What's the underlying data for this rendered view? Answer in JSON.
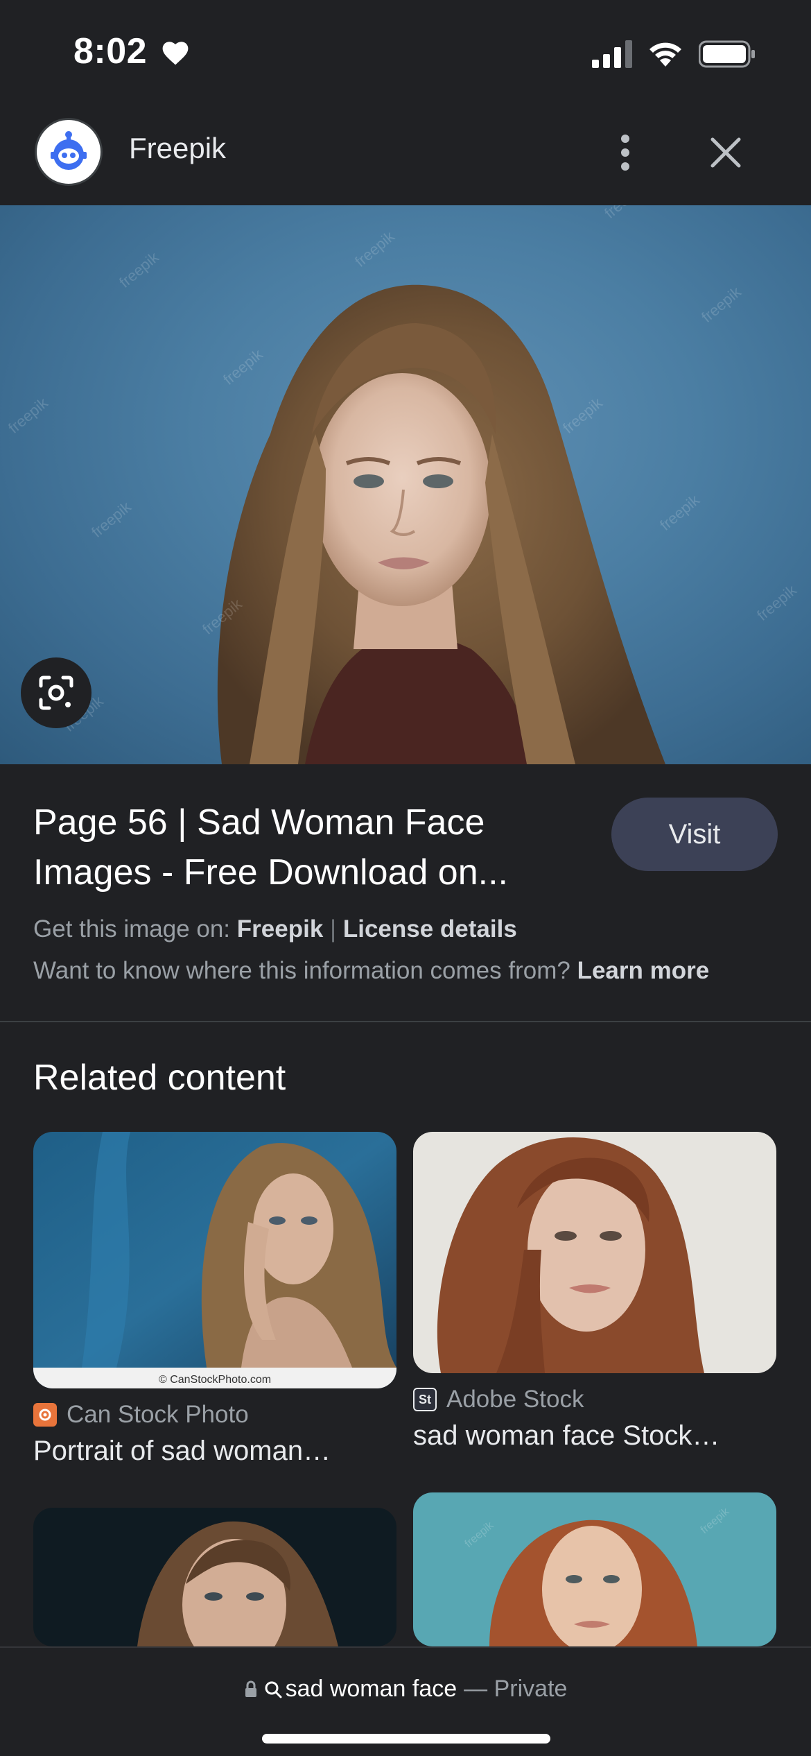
{
  "status_bar": {
    "time": "8:02",
    "icons": [
      "heart-icon",
      "cellular-signal-icon",
      "wifi-icon",
      "battery-icon"
    ]
  },
  "header": {
    "site_name": "Freepik",
    "avatar_icon": "freepik-robot-logo",
    "menu_icon": "more-vert-icon",
    "close_icon": "close-icon"
  },
  "hero": {
    "lens_icon": "google-lens-icon",
    "watermark_text": "freepik"
  },
  "result": {
    "title": "Page 56 | Sad Woman Face Images - Free Download on...",
    "visit_label": "Visit",
    "get_image_prefix": "Get this image on:",
    "get_image_source": "Freepik",
    "separator": "|",
    "license_label": "License details",
    "info_prefix": "Want to know where this information comes from?",
    "learn_more_label": "Learn more"
  },
  "related": {
    "heading": "Related content",
    "items": [
      {
        "source": "Can Stock Photo",
        "title": "Portrait of sad woman…",
        "image_caption": "© CanStockPhoto.com",
        "source_color": "#e8743b"
      },
      {
        "source": "Adobe Stock",
        "title": "sad woman face Stock…",
        "source_badge": "St",
        "source_color": "#2c2f3a"
      }
    ]
  },
  "bottom_bar": {
    "query": "sad woman face",
    "mode": "— Private",
    "icons": [
      "lock-icon",
      "search-icon"
    ]
  },
  "colors": {
    "background": "#202124",
    "visit_button": "#3c4156",
    "text_primary": "#ffffff",
    "text_secondary": "#9aa0a6"
  }
}
